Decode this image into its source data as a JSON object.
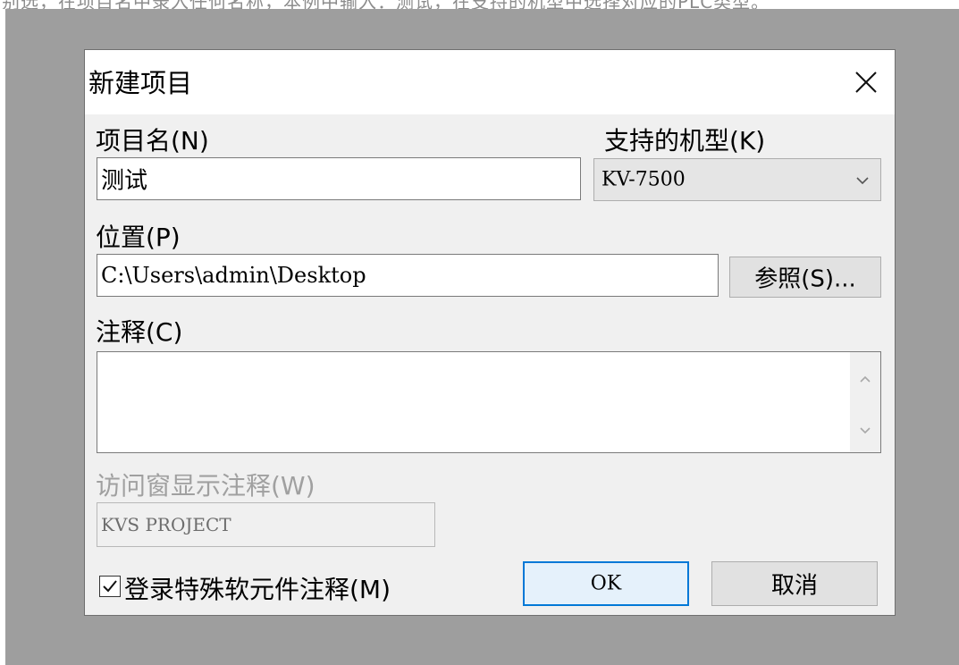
{
  "background_text": "别选，在项目名中录入任何名称，本例中输入：测试，在支持的机型中选择对应的PLC类型。",
  "dialog": {
    "title": "新建项目",
    "close_icon": "close-icon"
  },
  "project_name": {
    "label": "项目名(N)",
    "value": "测试"
  },
  "model": {
    "label": "支持的机型(K)",
    "value": "KV-7500",
    "arrow_icon": "chevron-down-icon"
  },
  "location": {
    "label": "位置(P)",
    "value": "C:\\Users\\admin\\Desktop",
    "browse_label": "参照(S)..."
  },
  "comment": {
    "label": "注释(C)",
    "value": ""
  },
  "access_window_comment": {
    "label": "访问窗显示注释(W)",
    "value": "KVS PROJECT"
  },
  "register_special": {
    "label": "登录特殊软元件注释(M)",
    "checked": true
  },
  "buttons": {
    "ok": "OK",
    "cancel": "取消"
  },
  "colors": {
    "ok_border": "#0078d7",
    "ok_background": "#e5f1fb",
    "dialog_background": "#f0f0f0",
    "backdrop": "#9e9e9e"
  }
}
